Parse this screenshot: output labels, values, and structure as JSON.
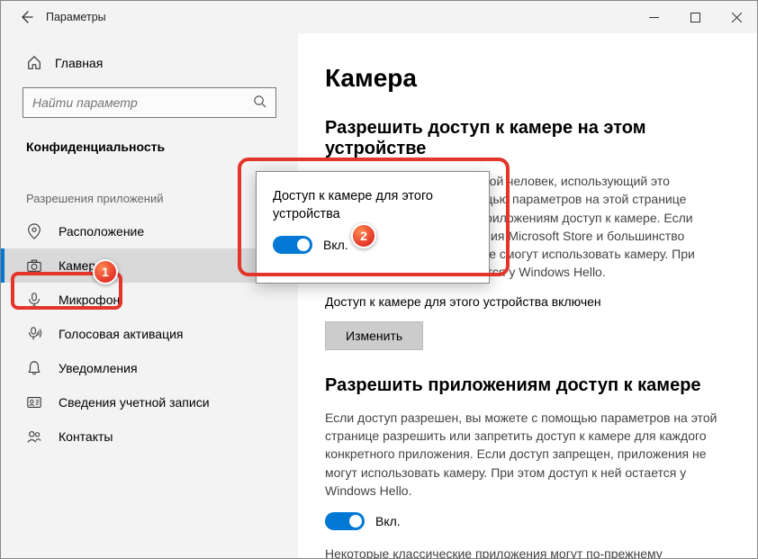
{
  "window": {
    "title": "Параметры"
  },
  "sidebar": {
    "home_label": "Главная",
    "search_placeholder": "Найти параметр",
    "section": "Конфиденциальность",
    "group": "Разрешения приложений",
    "items": [
      {
        "id": "location",
        "label": "Расположение"
      },
      {
        "id": "camera",
        "label": "Камера"
      },
      {
        "id": "microphone",
        "label": "Микрофон"
      },
      {
        "id": "voice-activation",
        "label": "Голосовая активация"
      },
      {
        "id": "notifications",
        "label": "Уведомления"
      },
      {
        "id": "account-info",
        "label": "Сведения учетной записи"
      },
      {
        "id": "contacts",
        "label": "Контакты"
      }
    ]
  },
  "content": {
    "title": "Камера",
    "section1_heading": "Разрешить доступ к камере на этом устройстве",
    "section1_body": "Если доступ разрешен, любой человек, использующий это устройство, сможет с помощью параметров на этой странице разрешить или запретить приложениям доступ к камере. Если доступ запрещен, приложения Microsoft Store и большинство классических приложений не смогут использовать камеру. При этом доступ к камере остается у Windows Hello.",
    "device_status": "Доступ к камере для этого устройства включен",
    "change_button": "Изменить",
    "section2_heading": "Разрешить приложениям доступ к камере",
    "section2_body": "Если доступ разрешен, вы можете с помощью параметров на этой странице разрешить или запретить доступ к камере для каждого конкретного приложения. Если доступ запрещен, приложения не могут использовать камеру. При этом доступ к ней остается у Windows Hello.",
    "toggle_label": "Вкл.",
    "footer_text": "Некоторые классические приложения могут по-прежнему"
  },
  "popup": {
    "title": "Доступ к камере для этого устройства",
    "toggle_label": "Вкл."
  },
  "annotations": {
    "badge1": "1",
    "badge2": "2"
  }
}
